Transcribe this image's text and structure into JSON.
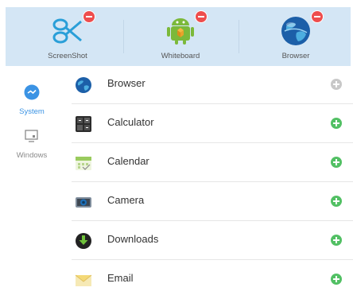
{
  "shortcuts": [
    {
      "label": "ScreenShot",
      "icon": "scissors-icon"
    },
    {
      "label": "Whiteboard",
      "icon": "android-icon"
    },
    {
      "label": "Browser",
      "icon": "globe-icon"
    }
  ],
  "categories": [
    {
      "label": "System",
      "icon": "system-icon",
      "selected": true
    },
    {
      "label": "Windows",
      "icon": "windows-icon",
      "selected": false
    }
  ],
  "apps": [
    {
      "name": "Browser",
      "icon": "globe-icon",
      "state": "added"
    },
    {
      "name": "Calculator",
      "icon": "calculator-icon",
      "state": "add"
    },
    {
      "name": "Calendar",
      "icon": "calendar-icon",
      "state": "add"
    },
    {
      "name": "Camera",
      "icon": "camera-icon",
      "state": "add"
    },
    {
      "name": "Downloads",
      "icon": "download-icon",
      "state": "add"
    },
    {
      "name": "Email",
      "icon": "email-icon",
      "state": "add"
    }
  ],
  "colors": {
    "topbar_bg": "#d4e6f5",
    "accent": "#3b93e4",
    "remove_badge": "#ee4d4d",
    "add_button": "#52c064",
    "added_button": "#c8c8c8"
  }
}
